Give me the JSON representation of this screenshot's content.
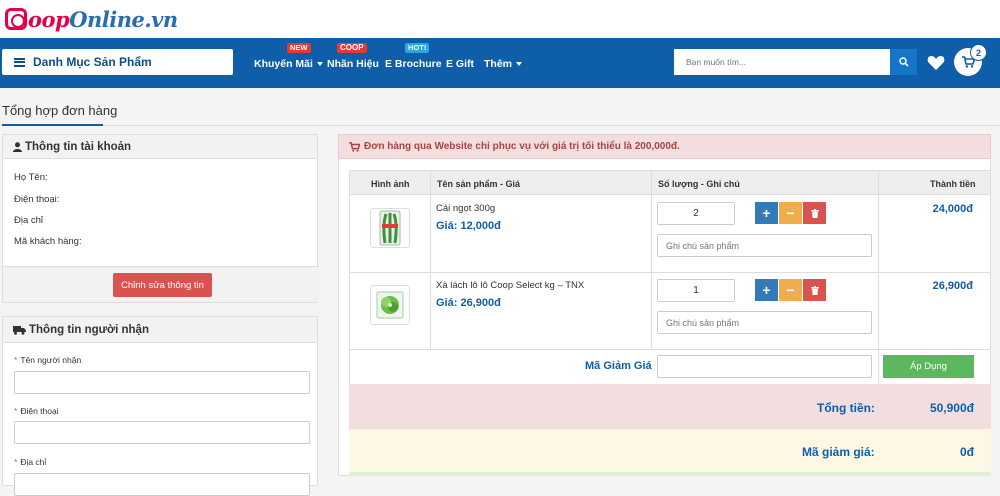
{
  "logo": {
    "part1": "oop",
    "part2": "Online.vn"
  },
  "nav": {
    "category_button": "Danh Mục Sản Phẩm",
    "items": [
      {
        "label": "Khuyến Mãi",
        "badge": "NEW",
        "dropdown": true
      },
      {
        "label": "Nhãn Hiệu",
        "badge": "COOP",
        "dropdown": false
      },
      {
        "label": "E Brochure",
        "badge": "HOT!",
        "dropdown": false
      },
      {
        "label": "E Gift",
        "badge": "",
        "dropdown": false
      },
      {
        "label": "Thêm",
        "badge": "",
        "dropdown": true
      }
    ],
    "search_placeholder": "Bạn muốn tìm...",
    "cart_count": "2",
    "icons": [
      "search-icon",
      "heart-icon",
      "cart-icon"
    ]
  },
  "page_title": "Tổng hợp đơn hàng",
  "account": {
    "title": "Thông tin tài khoản",
    "fields": [
      "Họ Tên:",
      "Điện thoại:",
      "Địa chỉ",
      "Mã khách hàng:"
    ],
    "edit_button": "Chỉnh sửa thông tin"
  },
  "recipient": {
    "title": "Thông tin người nhận",
    "fields": [
      "Tên người nhận",
      "Điện thoại",
      "Địa chỉ"
    ]
  },
  "notice": "Đơn hàng qua Website chỉ phục vụ với giá trị tối thiểu là 200,000đ.",
  "cart": {
    "headers": [
      "Hình ảnh",
      "Tên sản phẩm - Giá",
      "Số lượng - Ghi chú",
      "Thành tiền"
    ],
    "items": [
      {
        "name": "Cải ngọt 300g",
        "price": "Giá: 12,000đ",
        "qty": "2",
        "note_placeholder": "Ghi chú sản phẩm",
        "total": "24,000đ"
      },
      {
        "name": "Xà lách lô lô Coop Select kg – TNX",
        "price": "Giá: 26,900đ",
        "qty": "1",
        "note_placeholder": "Ghi chú sản phẩm",
        "total": "26,900đ"
      }
    ],
    "coupon_label": "Mã Giảm Giá",
    "apply_button": "Áp Dụng",
    "total_label": "Tổng tiền:",
    "total_value": "50,900đ",
    "discount_label": "Mã giảm giá:",
    "discount_value": "0đ"
  },
  "colors": {
    "brand_blue": "#0f5ea9",
    "logo_pink": "#e5004b",
    "danger": "#d9534f",
    "warning": "#f0ad4e",
    "success": "#5cb85c"
  }
}
